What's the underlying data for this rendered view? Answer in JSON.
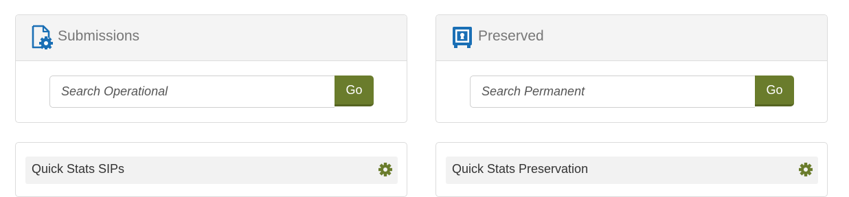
{
  "colors": {
    "accent_green": "#6a7c2c",
    "icon_blue": "#1a6fb5",
    "header_text": "#777777"
  },
  "submissions": {
    "title": "Submissions",
    "icon": "document-gear-icon",
    "search_placeholder": "Search Operational",
    "go_label": "Go"
  },
  "preserved": {
    "title": "Preserved",
    "icon": "vault-icon",
    "search_placeholder": "Search Permanent",
    "go_label": "Go"
  },
  "stats_sips": {
    "title": "Quick Stats SIPs",
    "icon": "gear-icon"
  },
  "stats_preservation": {
    "title": "Quick Stats Preservation",
    "icon": "gear-icon"
  }
}
